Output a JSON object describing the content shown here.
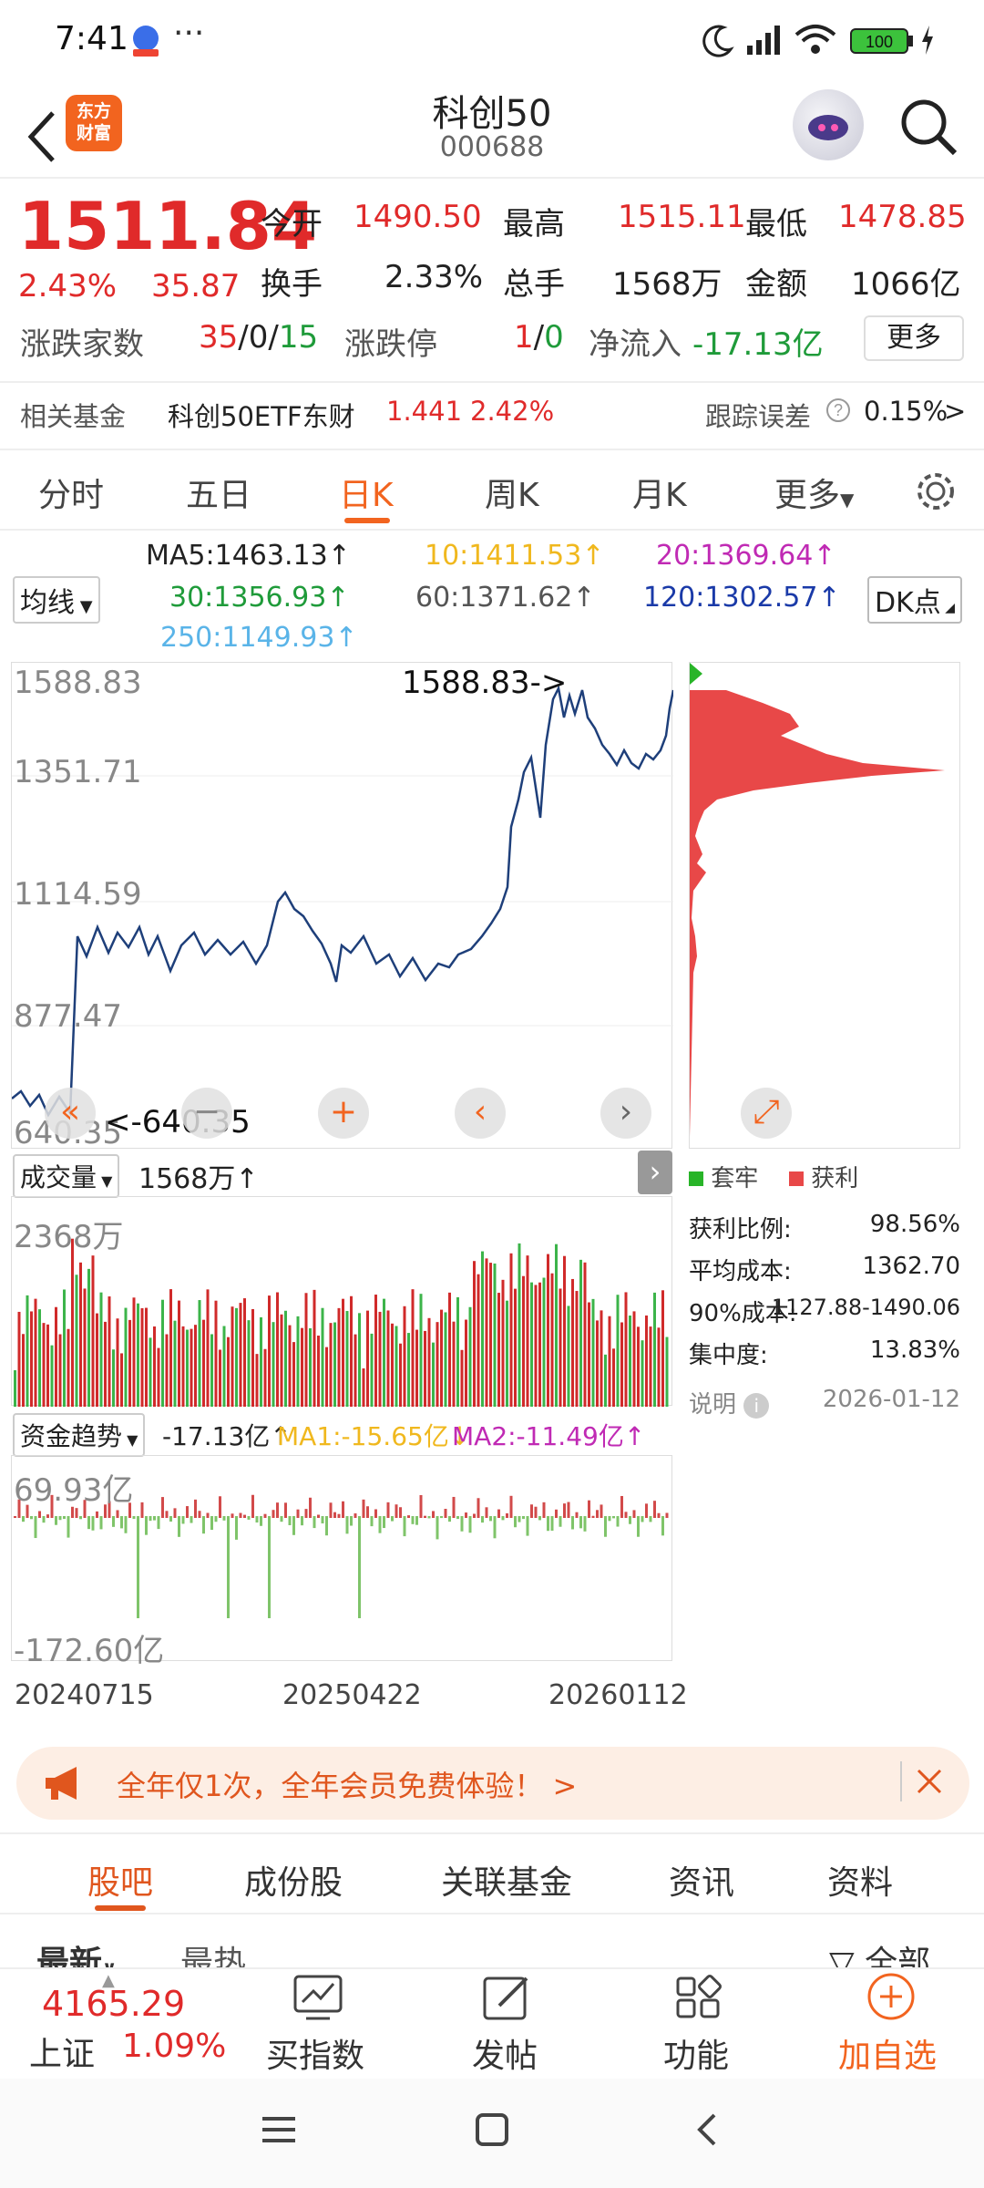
{
  "status": {
    "time": "7:41",
    "dots": "···",
    "battery": "100"
  },
  "header": {
    "logo": "东方财富",
    "title": "科创50",
    "code": "000688"
  },
  "quote": {
    "price": "1511.84",
    "pct": "2.43%",
    "chg": "35.87",
    "open_label": "今开",
    "open": "1490.50",
    "high_label": "最高",
    "high": "1515.11",
    "low_label": "最低",
    "low": "1478.85",
    "turnover_label": "换手",
    "turnover": "2.33%",
    "vol_label": "总手",
    "vol": "1568万",
    "amount_label": "金额",
    "amount": "1066亿",
    "breadth_label": "涨跌家数",
    "up": "35",
    "sep1": "/",
    "flat": "0",
    "sep2": "/",
    "down": "15",
    "limit_label": "涨跌停",
    "limit_up": "1",
    "sep3": "/",
    "limit_down": "0",
    "netflow_label": "净流入",
    "netflow": "-17.13亿",
    "more": "更多"
  },
  "fund": {
    "label": "相关基金",
    "name": "科创50ETF东财",
    "price": "1.441",
    "pct": "2.42%",
    "err_label": "跟踪误差",
    "err": "0.15%",
    "arrow": ">"
  },
  "tabs": [
    "分时",
    "五日",
    "日K",
    "周K",
    "月K",
    "更多"
  ],
  "ma": {
    "selector": "均线",
    "dk": "DK点",
    "ma5": "MA5:1463.13↑",
    "ma10": "10:1411.53↑",
    "ma20": "20:1369.64↑",
    "ma30": "30:1356.93↑",
    "ma60": "60:1371.62↑",
    "ma120": "120:1302.57↑",
    "ma250": "250:1149.93↑",
    "colors": {
      "ma5": "#222222",
      "ma10": "#f0b81e",
      "ma20": "#c02ab4",
      "ma30": "#1f9b3a",
      "ma60": "#555555",
      "ma120": "#1a3aa8",
      "ma250": "#5ab4e8"
    }
  },
  "kchart": {
    "y_labels": [
      "1588.83",
      "1351.71",
      "1114.59",
      "877.47",
      "640.35"
    ],
    "max_marker": "1588.83->",
    "min_marker": "<-640.35",
    "line_color": "#1e3f7a"
  },
  "chip": {
    "legend_trapped": "套牢",
    "legend_profit": "获利",
    "rows": [
      {
        "k": "获利比例:",
        "v": "98.56%"
      },
      {
        "k": "平均成本:",
        "v": "1362.70"
      },
      {
        "k": "90%成本:",
        "v": "1127.88-1490.06"
      },
      {
        "k": "集中度:",
        "v": "13.83%"
      }
    ],
    "note": "说明",
    "date": "2026-01-12"
  },
  "volume": {
    "selector": "成交量",
    "value": "1568万↑",
    "max_label": "2368万"
  },
  "flow": {
    "selector": "资金趋势",
    "value": "-17.13亿↑",
    "ma1": "MA1:-15.65亿↓",
    "ma2": "MA2:-11.49亿↑",
    "max_label": "69.93亿",
    "min_label": "-172.60亿"
  },
  "dates": [
    "20240715",
    "20250422",
    "20260112"
  ],
  "banner": {
    "text": "全年仅1次，全年会员免费体验！ >"
  },
  "subtabs": [
    "股吧",
    "成份股",
    "关联基金",
    "资讯",
    "资料"
  ],
  "partial": {
    "latest": "最新",
    "hot": "最热",
    "all": "全部"
  },
  "bottom": {
    "index_value": "4165.29",
    "index_name": "上证",
    "index_pct": "1.09%",
    "buy": "买指数",
    "post": "发帖",
    "func": "功能",
    "add": "加自选"
  }
}
